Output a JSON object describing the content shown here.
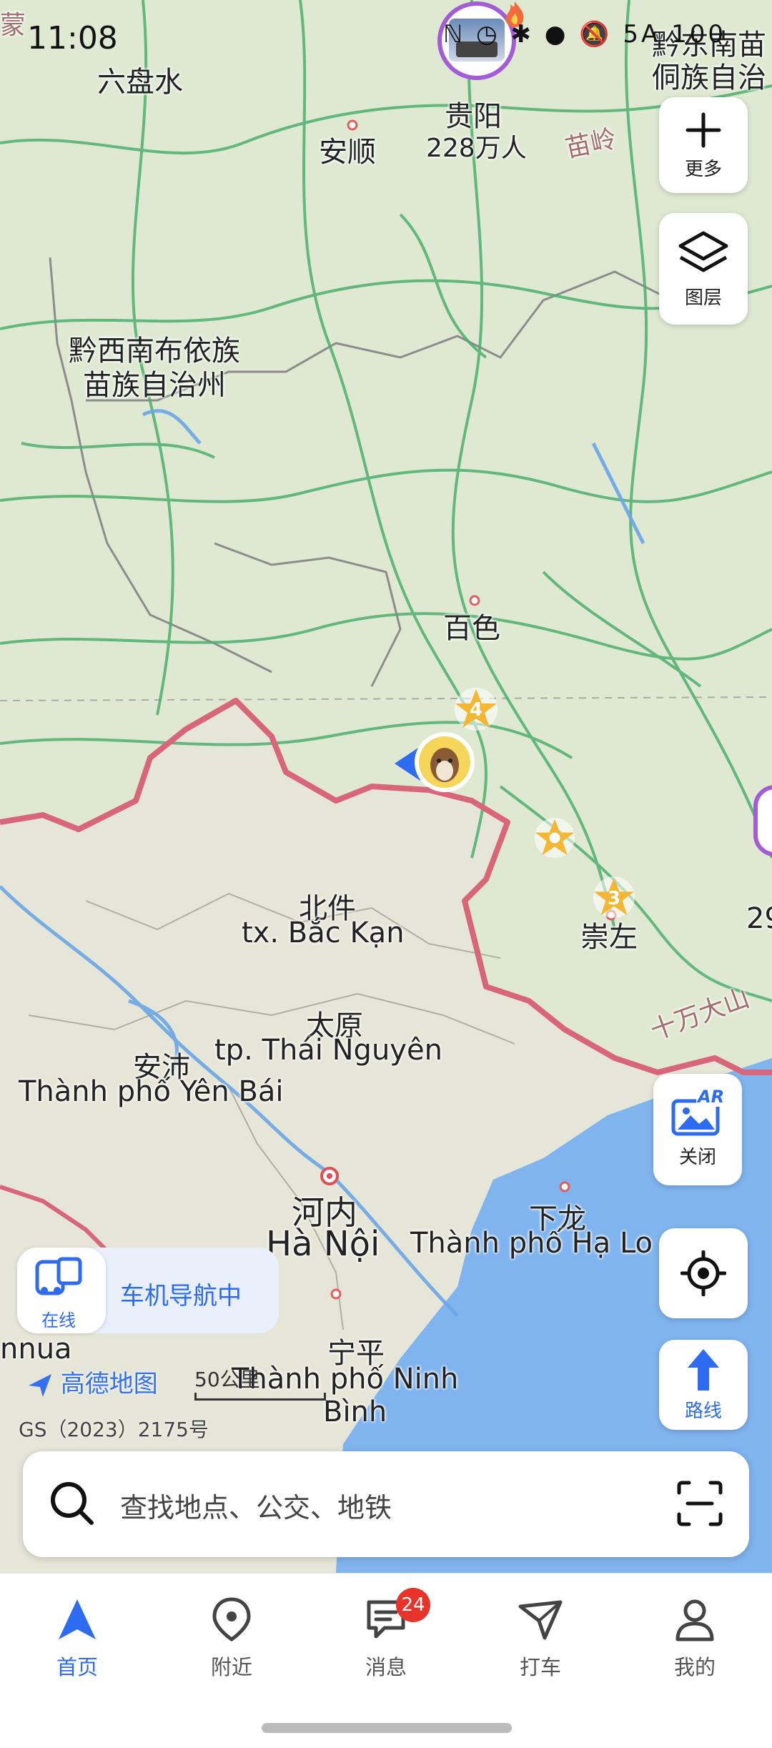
{
  "status_bar": {
    "time": "11:08",
    "icons": "ℕ ◷ ✱ ● 🔕 5A 100"
  },
  "map_labels": [
    {
      "id": "liupanshui",
      "text": "六盘水"
    },
    {
      "id": "anshun",
      "text": "安顺"
    },
    {
      "id": "guiyang",
      "text": "贵阳"
    },
    {
      "id": "guiyang_pop",
      "text": "228万人"
    },
    {
      "id": "qiandongnan",
      "text": "黔东南苗"
    },
    {
      "id": "qiandongnan2",
      "text": "侗族自治"
    },
    {
      "id": "miaoling",
      "text": "苗岭"
    },
    {
      "id": "qianxinan1",
      "text": "黔西南布依族"
    },
    {
      "id": "qianxinan2",
      "text": "苗族自治州"
    },
    {
      "id": "baise",
      "text": "百色"
    },
    {
      "id": "chongzuo",
      "text": "崇左"
    },
    {
      "id": "shiwandashan",
      "text": "十万大山"
    },
    {
      "id": "bacgiang_cn",
      "text": "北件"
    },
    {
      "id": "backan_vn",
      "text": "tx. Bắc Kạn"
    },
    {
      "id": "thainguyen_cn",
      "text": "太原"
    },
    {
      "id": "thainguyen_vn",
      "text": "tp. Thái Nguyên"
    },
    {
      "id": "yenbai_cn",
      "text": "安沛"
    },
    {
      "id": "yenbai_vn",
      "text": "Thành phố Yên Bái"
    },
    {
      "id": "hanoi_cn",
      "text": "河内"
    },
    {
      "id": "hanoi_vn",
      "text": "Hà Nội"
    },
    {
      "id": "halong_cn",
      "text": "下龙"
    },
    {
      "id": "halong_vn",
      "text": "Thành phố Hạ Lo"
    },
    {
      "id": "ninhbinh_cn",
      "text": "宁平"
    },
    {
      "id": "ninhbinh_vn1",
      "text": "Thành phố Ninh"
    },
    {
      "id": "ninhbinh_vn2",
      "text": "Bình"
    },
    {
      "id": "edge_left",
      "text": "nnua"
    },
    {
      "id": "edge_right",
      "text": "29"
    },
    {
      "id": "edge_topleft",
      "text": "蒙"
    }
  ],
  "markers": {
    "star_a": "4",
    "star_c": "3"
  },
  "controls": {
    "more_label": "更多",
    "layers_label": "图层",
    "ar_label": "关闭",
    "ar_badge": "AR",
    "route_label": "路线"
  },
  "car_nav": {
    "status": "在线",
    "text": "车机导航中"
  },
  "map_footer": {
    "brand": "高德地图",
    "scale": "50公里",
    "gs": "GS（2023）2175号"
  },
  "search": {
    "placeholder": "查找地点、公交、地铁"
  },
  "tabs": [
    {
      "label": "首页"
    },
    {
      "label": "附近"
    },
    {
      "label": "消息",
      "badge": "24"
    },
    {
      "label": "打车"
    },
    {
      "label": "我的"
    }
  ],
  "colors": {
    "accent": "#2c6bf2",
    "land": "#dfe9d2",
    "vietnam_land": "#e6e6d8",
    "sea": "#7fb4ee",
    "border": "#d9657a",
    "road": "#4caf6e",
    "star": "#f5b731",
    "badge": "#e8332b"
  }
}
